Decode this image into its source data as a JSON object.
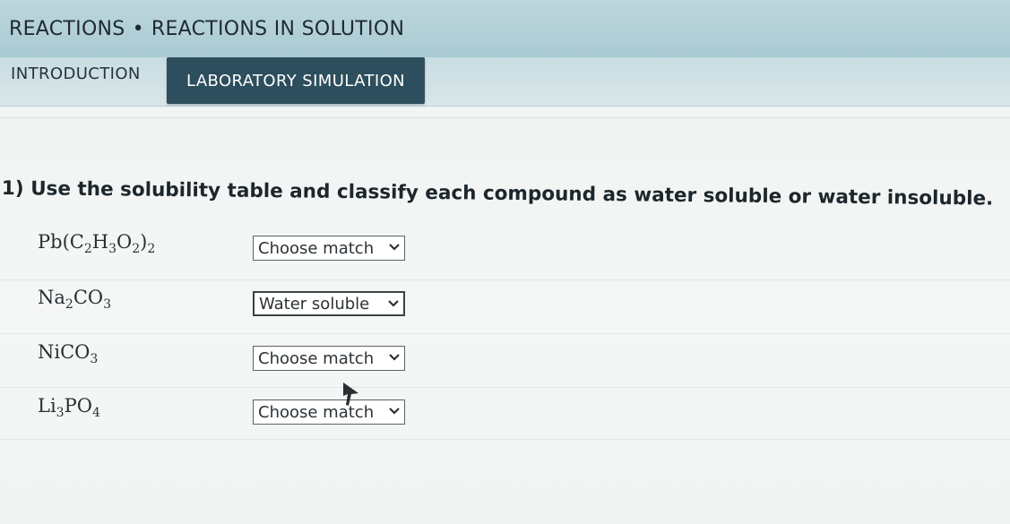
{
  "breadcrumb": {
    "section": "REACTIONS",
    "separator": "•",
    "topic": "REACTIONS IN SOLUTION"
  },
  "tabs": [
    {
      "label": "INTRODUCTION",
      "active": false
    },
    {
      "label": "LABORATORY SIMULATION",
      "active": true
    }
  ],
  "question": {
    "text": "1) Use the solubility table and classify each compound as water soluble or water insoluble."
  },
  "rows": [
    {
      "compound_parts": [
        "Pb(C",
        "2",
        "H",
        "3",
        "O",
        "2",
        ")",
        "2"
      ],
      "selection": "Choose match"
    },
    {
      "compound_parts": [
        "Na",
        "2",
        "CO",
        "3"
      ],
      "selection": "Water soluble"
    },
    {
      "compound_parts": [
        "NiCO",
        "3"
      ],
      "selection": "Choose match"
    },
    {
      "compound_parts": [
        "Li",
        "3",
        "PO",
        "4"
      ],
      "selection": "Choose match"
    }
  ],
  "icons": {
    "dropdown": "chevron-down-icon",
    "pointer": "mouse-pointer-icon"
  },
  "colors": {
    "active_tab_bg": "#2d4e5c",
    "header_bg": "#a9cad3"
  }
}
